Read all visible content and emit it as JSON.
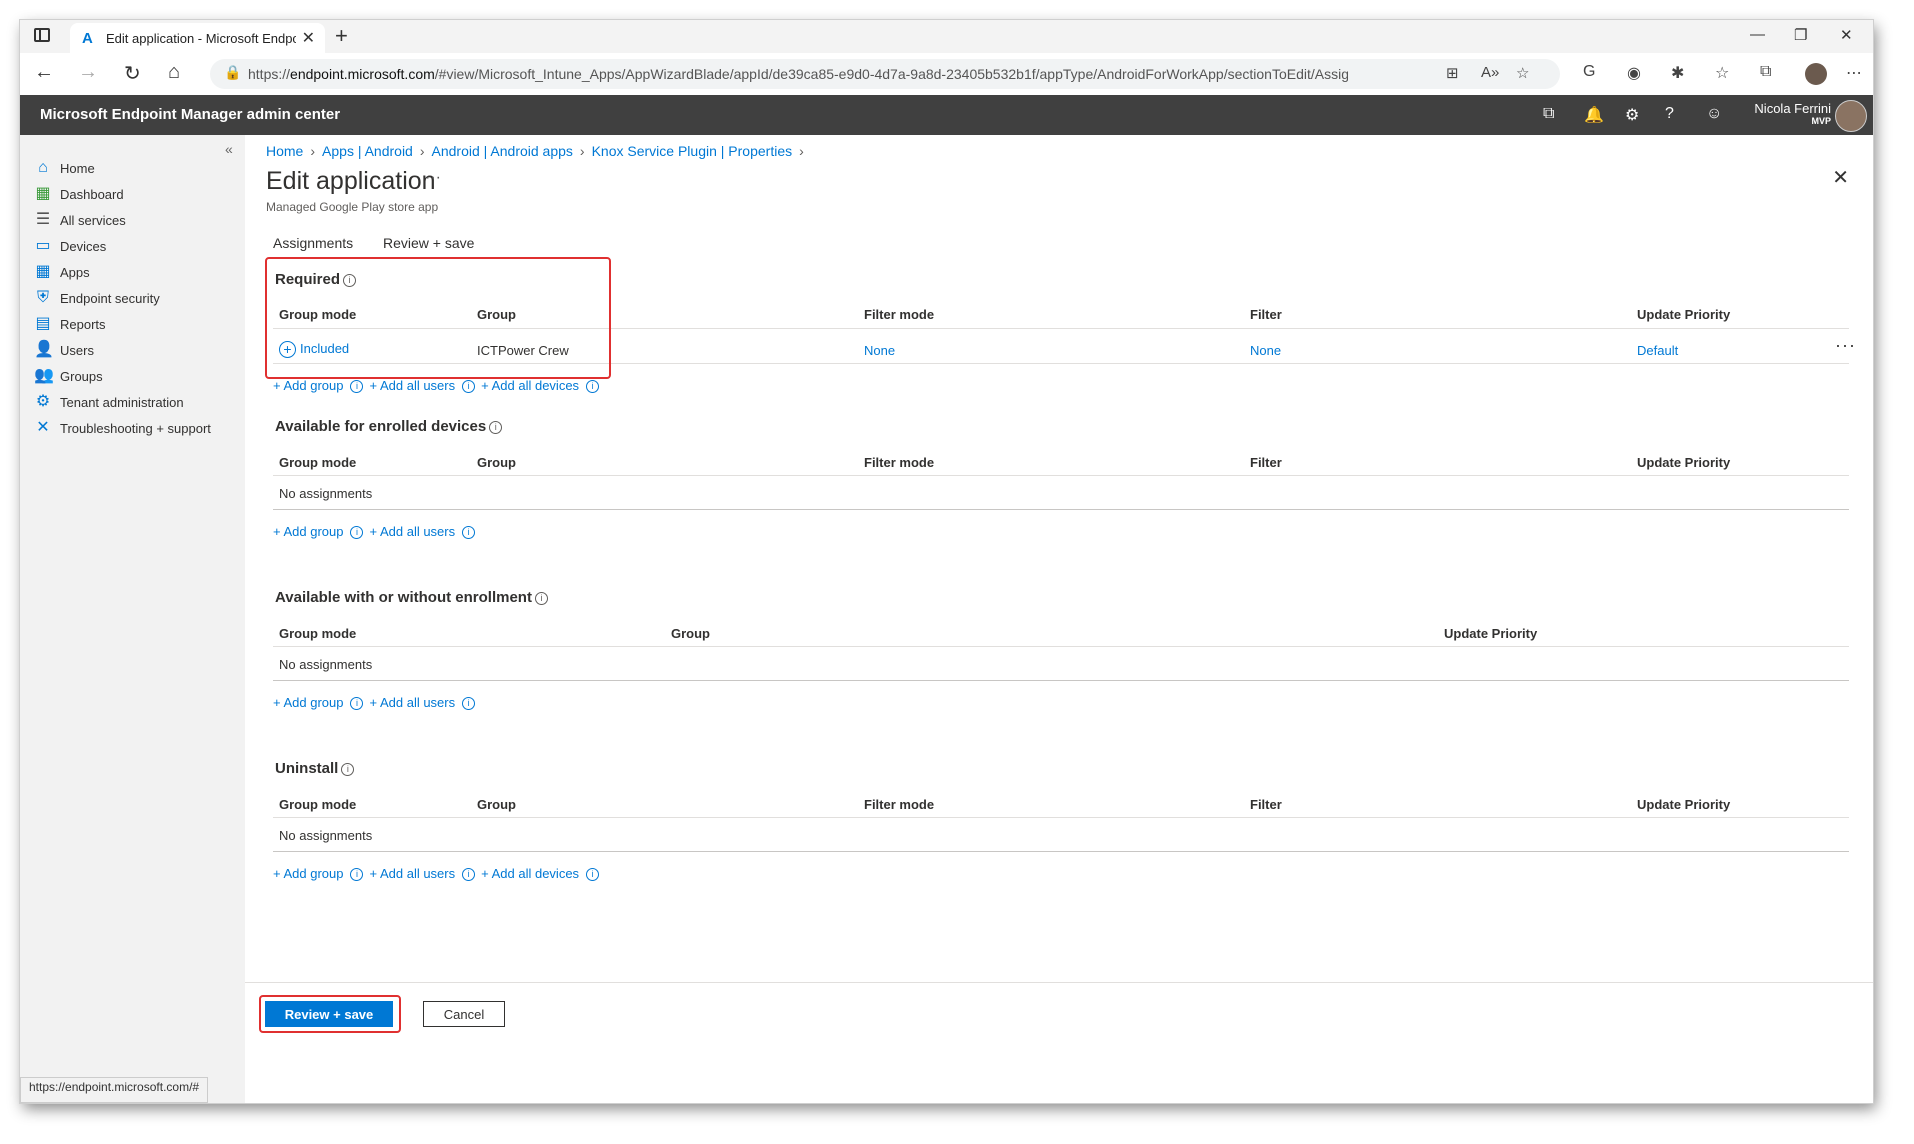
{
  "browser": {
    "tab_title": "Edit application - Microsoft Endpoint",
    "url_prefix": "https://",
    "url_host": "endpoint.microsoft.com",
    "url_rest": "/#view/Microsoft_Intune_Apps/AppWizardBlade/appId/de39ca85-e9d0-4d7a-9a8d-23405b532b1f/appType/AndroidForWorkApp/sectionToEdit/Assignments...",
    "status_url": "https://endpoint.microsoft.com/#"
  },
  "header": {
    "brand": "Microsoft Endpoint Manager admin center",
    "user_name": "Nicola Ferrini",
    "user_badge": "MVP"
  },
  "sidebar": {
    "items": [
      {
        "label": "Home",
        "icon": "home-icon"
      },
      {
        "label": "Dashboard",
        "icon": "dashboard-icon"
      },
      {
        "label": "All services",
        "icon": "list-icon"
      },
      {
        "label": "Devices",
        "icon": "devices-icon"
      },
      {
        "label": "Apps",
        "icon": "apps-icon"
      },
      {
        "label": "Endpoint security",
        "icon": "shield-icon"
      },
      {
        "label": "Reports",
        "icon": "reports-icon"
      },
      {
        "label": "Users",
        "icon": "user-icon"
      },
      {
        "label": "Groups",
        "icon": "groups-icon"
      },
      {
        "label": "Tenant administration",
        "icon": "tenant-icon"
      },
      {
        "label": "Troubleshooting + support",
        "icon": "tools-icon"
      }
    ]
  },
  "breadcrumb": [
    "Home",
    "Apps | Android",
    "Android | Android apps",
    "Knox Service Plugin | Properties"
  ],
  "page": {
    "title": "Edit application",
    "subtitle": "Managed Google Play store app"
  },
  "tabs": [
    "Assignments",
    "Review + save"
  ],
  "columns": {
    "group_mode": "Group mode",
    "group": "Group",
    "filter_mode": "Filter mode",
    "filter": "Filter",
    "update_priority": "Update Priority"
  },
  "links": {
    "add_group": "+ Add group",
    "add_all_users": "+ Add all users",
    "add_all_devices": "+ Add all devices"
  },
  "sections": {
    "required": {
      "title": "Required",
      "row": {
        "group_mode": "Included",
        "group": "ICTPower Crew",
        "filter_mode": "None",
        "filter": "None",
        "update_priority": "Default"
      }
    },
    "available_enrolled": {
      "title": "Available for enrolled devices",
      "empty": "No assignments"
    },
    "available_without": {
      "title": "Available with or without enrollment",
      "empty": "No assignments"
    },
    "uninstall": {
      "title": "Uninstall",
      "empty": "No assignments"
    }
  },
  "footer": {
    "review_save": "Review + save",
    "cancel": "Cancel"
  },
  "colors": {
    "accent": "#0078d4",
    "header_bg": "#404040",
    "highlight": "#e03030"
  }
}
